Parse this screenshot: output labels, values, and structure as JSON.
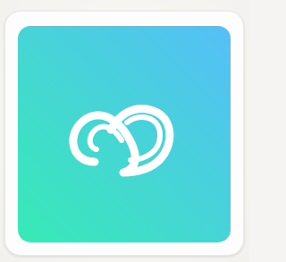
{
  "app_icon": {
    "icon": "infinity-loop-logo-icon",
    "gradient_top_right": "#55bff8",
    "gradient_bottom_left": "#37eab5",
    "glyph_color": "#ffffff"
  }
}
